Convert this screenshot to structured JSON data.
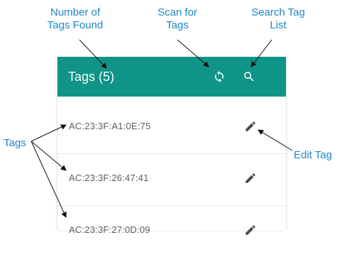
{
  "callouts": {
    "count_line1": "Number of",
    "count_line2": "Tags Found",
    "scan_line1": "Scan for",
    "scan_line2": "Tags",
    "search_line1": "Search Tag",
    "search_line2": "List",
    "tags": "Tags",
    "edit": "Edit Tag"
  },
  "header": {
    "title": "Tags (5)",
    "scan_icon": "refresh-icon",
    "search_icon": "search-icon"
  },
  "tags": [
    {
      "id": "AC:23:3F:A1:0E:75",
      "icon": "pencil-icon"
    },
    {
      "id": "AC:23:3F:26:47:41",
      "icon": "pencil-icon"
    },
    {
      "id": "AC:23:3F:27:0D:09",
      "icon": "pencil-icon"
    }
  ],
  "colors": {
    "header_bg": "#0f9487",
    "callout_text": "#1f86c6",
    "tag_text": "#5c5c5c",
    "icon": "#4a4a4a"
  }
}
